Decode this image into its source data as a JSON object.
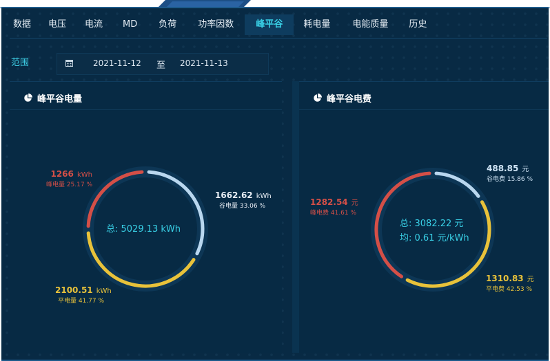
{
  "tabs": [
    "数据",
    "电压",
    "电流",
    "MD",
    "负荷",
    "功率因数",
    "峰平谷",
    "耗电量",
    "电能质量",
    "历史"
  ],
  "active_tab": "峰平谷",
  "range": {
    "label": "范围",
    "start": "2021-11-12",
    "separator": "至",
    "end": "2021-11-13"
  },
  "colors": {
    "peak": "#d44f47",
    "flat": "#e8c23a",
    "valley": "#b9d7ef",
    "accent": "#39d0e6"
  },
  "energy": {
    "title": "峰平谷电量",
    "total_label": "总: 5029.13 kWh",
    "segments": [
      {
        "key": "valley",
        "value": "1662.62",
        "unit": "kWh",
        "sub": "谷电量 33.06 %"
      },
      {
        "key": "flat",
        "value": "2100.51",
        "unit": "kWh",
        "sub": "平电量 41.77 %"
      },
      {
        "key": "peak",
        "value": "1266",
        "unit": "kWh",
        "sub": "峰电量 25.17 %"
      }
    ],
    "chart_data": {
      "type": "pie",
      "categories": [
        "谷电量",
        "平电量",
        "峰电量"
      ],
      "values": [
        33.06,
        41.77,
        25.17
      ]
    }
  },
  "cost": {
    "title": "峰平谷电费",
    "total_label": "总:  3082.22 元",
    "avg_label": "均:  0.61 元/kWh",
    "segments": [
      {
        "key": "valley",
        "value": "488.85",
        "unit": "元",
        "sub": "谷电费 15.86 %"
      },
      {
        "key": "flat",
        "value": "1310.83",
        "unit": "元",
        "sub": "平电费 42.53 %"
      },
      {
        "key": "peak",
        "value": "1282.54",
        "unit": "元",
        "sub": "峰电费 41.61 %"
      }
    ],
    "chart_data": {
      "type": "pie",
      "categories": [
        "谷电费",
        "平电费",
        "峰电费"
      ],
      "values": [
        15.86,
        42.53,
        41.61
      ]
    }
  }
}
